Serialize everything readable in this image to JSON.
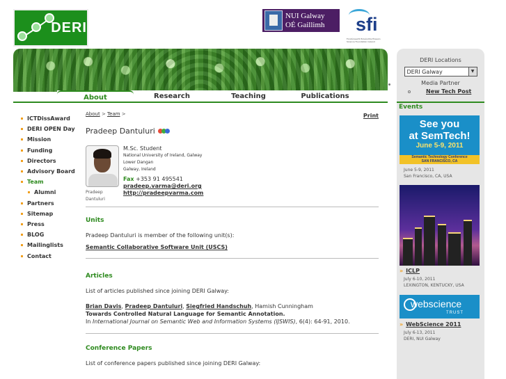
{
  "header": {
    "logo_text": "DERI",
    "nuig_line1": "NUI Galway",
    "nuig_line2": "OÉ Gaillimh",
    "sfi_text": "sfi",
    "sfi_small": "Fondúireacht Eolaíochta Éireann Science Foundation Ireland"
  },
  "nav": {
    "tabs": [
      {
        "label": "About"
      },
      {
        "label": "Research"
      },
      {
        "label": "Teaching"
      },
      {
        "label": "Publications"
      }
    ]
  },
  "leftnav": {
    "items": [
      {
        "label": "ICTDissAward"
      },
      {
        "label": "DERI OPEN Day"
      },
      {
        "label": "Mission"
      },
      {
        "label": "Funding"
      },
      {
        "label": "Directors"
      },
      {
        "label": "Advisory Board"
      },
      {
        "label": "Team"
      },
      {
        "label": "Alumni"
      },
      {
        "label": "Partners"
      },
      {
        "label": "Sitemap"
      },
      {
        "label": "Press"
      },
      {
        "label": "BLOG"
      },
      {
        "label": "Mailinglists"
      },
      {
        "label": "Contact"
      }
    ]
  },
  "breadcrumb": {
    "about": "About",
    "sep": ">",
    "team": "Team"
  },
  "print_label": "Print",
  "person": {
    "name": "Pradeep Dantuluri",
    "caption1": "Pradeep",
    "caption2": "Dantuluri",
    "role": "M.Sc. Student",
    "addr1": "National University of Ireland, Galway",
    "addr2": "Lower Dangan",
    "addr3": "Galway, Ireland",
    "fax_label": "Fax",
    "fax_number": "+353 91 495541",
    "email": "pradeep.varma@deri.org",
    "web": "http://pradeepvarma.com"
  },
  "units": {
    "heading": "Units",
    "intro": "Pradeep Dantuluri is member of the following unit(s):",
    "unit": "Semantic Collaborative Software Unit (USCS)"
  },
  "articles": {
    "heading": "Articles",
    "intro": "List of articles published since joining DERI Galway:",
    "author1": "Brian Davis",
    "author2": "Pradeep Dantuluri",
    "author3": "Siegfried Handschuh",
    "author4": "Hamish Cunningham",
    "title": "Towards Controlled Natural Language for Semantic Annotation.",
    "venue_prefix": "In",
    "venue": "International Journal on Semantic Web and Information Systems (IJSWIS)",
    "venue_suffix": ", 6(4): 64-91, 2010."
  },
  "conference": {
    "heading": "Conference Papers",
    "intro": "List of conference papers published since joining DERI Galway:"
  },
  "sidebar": {
    "locations_label": "DERI Locations",
    "location_selected": "DERI Galway",
    "media_partner_label": "Media Partner",
    "media_partner_link": "New Tech Post",
    "events_heading": "Events",
    "ad1_line1": "See you",
    "ad1_line2": "at SemTech!",
    "ad1_line3": "June 5-9, 2011",
    "ad1_line4": "Semantic Technology Conference",
    "ad1_line5": "SAN FRANCISCO, CA",
    "event1_date": "June 5-9, 2011",
    "event1_place": "San Francisco, CA, USA",
    "event2_title": "ICLP",
    "event2_date": "July 6-10, 2011",
    "event2_place": "LEXINGTON, KENTUCKY, USA",
    "ad3_text": "webscience",
    "ad3_trust": "TRUST",
    "event3_title": "WebScience 2011",
    "event3_date": "July 6-13, 2011",
    "event3_place": "DERI, NUI Galway"
  },
  "colors": {
    "accent": "#2d8a1e",
    "bullet": "#f0a020",
    "sidebar_bg": "#e6e6e6"
  }
}
